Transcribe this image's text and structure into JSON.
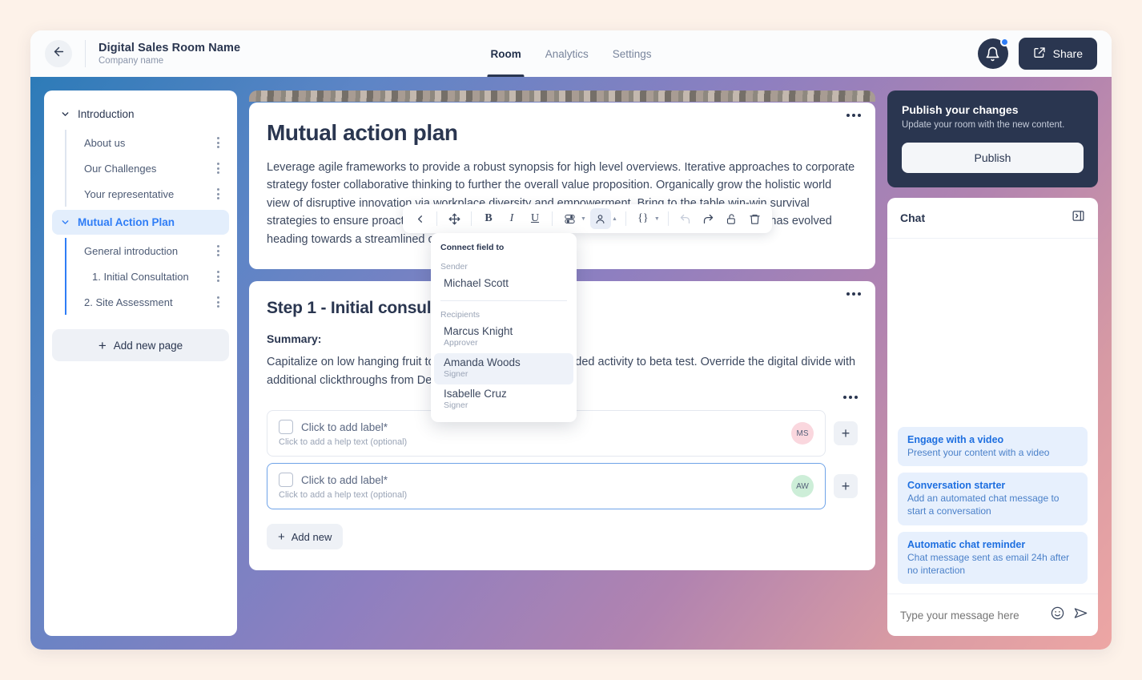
{
  "header": {
    "back_icon": "arrow-left-icon",
    "title": "Digital Sales Room Name",
    "subtitle": "Company name",
    "tabs": [
      {
        "label": "Room",
        "active": true
      },
      {
        "label": "Analytics",
        "active": false
      },
      {
        "label": "Settings",
        "active": false
      }
    ],
    "bell_icon": "bell-icon",
    "share_label": "Share",
    "share_icon": "share-icon"
  },
  "sidebar": {
    "groups": [
      {
        "label": "Introduction",
        "active": false,
        "items": [
          {
            "label": "About us"
          },
          {
            "label": "Our Challenges"
          },
          {
            "label": "Your representative"
          }
        ]
      },
      {
        "label": "Mutual Action Plan",
        "active": true,
        "items": [
          {
            "label": "General introduction"
          },
          {
            "label": "1. Initial Consultation"
          },
          {
            "label": "2. Site Assessment"
          }
        ]
      }
    ],
    "add_page_label": "Add new page"
  },
  "main": {
    "card1": {
      "title": "Mutual action plan",
      "body": "Leverage agile frameworks to provide a robust synopsis for high level overviews. Iterative approaches to corporate strategy foster collaborative thinking to further the overall value proposition. Organically grow the holistic world view of disruptive innovation via workplace diversity and empowerment. Bring to the table win-win survival strategies to ensure proactive domination. At the end of the day, going forward, a new normal that has evolved heading towards a streamlined cloud solution."
    },
    "card2": {
      "title": "Step 1 - Initial consultation",
      "summary_label": "Summary:",
      "summary_body": "Capitalize on low hanging fruit to identify a ballpark value added activity to beta test. Override the digital divide with additional clickthroughs from DevOps.",
      "fields": [
        {
          "label": "Click to add label*",
          "help": "Click to add a help text (optional)",
          "avatar": "MS",
          "selected": false
        },
        {
          "label": "Click to add label*",
          "help": "Click to add a help text (optional)",
          "avatar": "AW",
          "selected": true
        }
      ],
      "add_new_label": "Add new"
    }
  },
  "toolbar": {
    "items": [
      {
        "name": "collapse-left-icon",
        "glyph": "chevron-left"
      },
      {
        "name": "move-icon",
        "glyph": "move"
      },
      {
        "name": "bold-icon",
        "glyph": "B"
      },
      {
        "name": "italic-icon",
        "glyph": "I"
      },
      {
        "name": "underline-icon",
        "glyph": "U"
      },
      {
        "name": "field-type-icon",
        "glyph": "toggle"
      },
      {
        "name": "assign-person-icon",
        "glyph": "person"
      },
      {
        "name": "variable-icon",
        "glyph": "{}"
      },
      {
        "name": "undo-icon",
        "glyph": "undo"
      },
      {
        "name": "redo-icon",
        "glyph": "redo"
      },
      {
        "name": "lock-icon",
        "glyph": "lock"
      },
      {
        "name": "delete-icon",
        "glyph": "trash"
      }
    ]
  },
  "dropdown": {
    "title": "Connect field to",
    "sender_label": "Sender",
    "sender_name": "Michael Scott",
    "recipients_label": "Recipients",
    "recipients": [
      {
        "name": "Marcus Knight",
        "role": "Approver",
        "highlighted": false
      },
      {
        "name": "Amanda Woods",
        "role": "Signer",
        "highlighted": true
      },
      {
        "name": "Isabelle Cruz",
        "role": "Signer",
        "highlighted": false
      }
    ]
  },
  "right_panel": {
    "publish": {
      "title": "Publish your changes",
      "subtitle": "Update your room with the new content.",
      "button_label": "Publish"
    },
    "chat": {
      "title": "Chat",
      "collapse_icon": "panel-collapse-icon",
      "suggestions": [
        {
          "title": "Engage with a video",
          "sub": "Present your content with a video"
        },
        {
          "title": "Conversation starter",
          "sub": "Add an automated chat message to start a conversation"
        },
        {
          "title": "Automatic chat reminder",
          "sub": "Chat message sent as email 24h after no interaction"
        }
      ],
      "input_placeholder": "Type your message here",
      "emoji_icon": "emoji-icon",
      "send_icon": "send-icon"
    }
  },
  "colors": {
    "accent_blue": "#2f7df6",
    "dark_navy": "#2a3650",
    "avatar_ms": "#fad7de",
    "avatar_aw": "#cdeed8",
    "page_bg": "#fdf2e9"
  }
}
